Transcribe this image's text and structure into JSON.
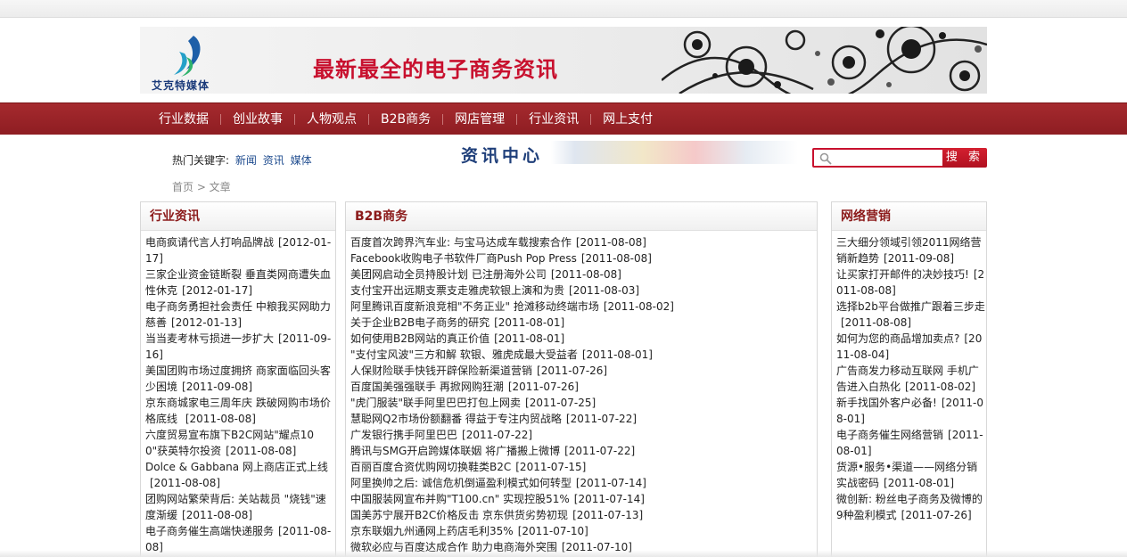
{
  "header": {
    "logo_text": "艾克特媒体",
    "slogan": "最新最全的电子商务资讯"
  },
  "nav": {
    "items": [
      "行业数据",
      "创业故事",
      "人物观点",
      "B2B商务",
      "网店管理",
      "行业资讯",
      "网上支付"
    ]
  },
  "hot_keywords": {
    "label": "热门关键字:",
    "words": [
      "新闻",
      "资讯",
      "媒体"
    ]
  },
  "center_banner": {
    "title": "资讯中心"
  },
  "search": {
    "placeholder": "",
    "button_label": "搜 索"
  },
  "breadcrumb": "首页 > 文章",
  "columns": {
    "left": {
      "title": "行业资讯",
      "items": [
        {
          "title": "电商疯请代言人打响品牌战",
          "date": "[2012-01-17]"
        },
        {
          "title": "三家企业资金链断裂 垂直类网商遭失血性休克",
          "date": "[2012-01-17]"
        },
        {
          "title": "电子商务勇担社会责任 中粮我买网助力慈善",
          "date": "[2012-01-13]"
        },
        {
          "title": "当当麦考林亏损进一步扩大",
          "date": "[2011-09-16]"
        },
        {
          "title": "美国团购市场过度拥挤 商家面临回头客少困境",
          "date": "[2011-09-08]"
        },
        {
          "title": "京东商城家电三周年庆 跌破网购市场价格底线 ",
          "date": "[2011-08-08]"
        },
        {
          "title": "六度贸易宣布旗下B2C网站\"耀点100\"获英特尔投资",
          "date": "[2011-08-08]"
        },
        {
          "title": "Dolce & Gabbana 网上商店正式上线",
          "date": "[2011-08-08]"
        },
        {
          "title": "团购网站繁荣背后: 关站裁员 \"烧钱\"速度渐缓",
          "date": "[2011-08-08]"
        },
        {
          "title": "电子商务催生高端快递服务",
          "date": "[2011-08-08]"
        }
      ]
    },
    "middle": {
      "title": "B2B商务",
      "items": [
        {
          "title": "百度首次跨界汽车业: 与宝马达成车载搜索合作",
          "date": "[2011-08-08]"
        },
        {
          "title": "Facebook收购电子书软件厂商Push Pop Press",
          "date": "[2011-08-08]"
        },
        {
          "title": "美团网启动全员持股计划 已注册海外公司",
          "date": "[2011-08-08]"
        },
        {
          "title": "支付宝开出远期支票支走雅虎软银上演和为贵",
          "date": "[2011-08-03]"
        },
        {
          "title": "阿里腾讯百度新浪竞相\"不务正业\" 抢滩移动终端市场",
          "date": "[2011-08-02]"
        },
        {
          "title": "关于企业B2B电子商务的研究",
          "date": "[2011-08-01]"
        },
        {
          "title": "如何使用B2B网站的真正价值",
          "date": "[2011-08-01]"
        },
        {
          "title": "\"支付宝风波\"三方和解 软银、雅虎成最大受益者",
          "date": "[2011-08-01]"
        },
        {
          "title": "人保财险联手快钱开辟保险新渠道营销",
          "date": "[2011-07-26]"
        },
        {
          "title": "百度国美强强联手 再掀网购狂潮",
          "date": "[2011-07-26]"
        },
        {
          "title": "\"虎门服装\"联手阿里巴巴打包上网卖",
          "date": "[2011-07-25]"
        },
        {
          "title": "慧聪网Q2市场份额翻番 得益于专注内贸战略",
          "date": "[2011-07-22]"
        },
        {
          "title": "广发银行携手阿里巴巴",
          "date": "[2011-07-22]"
        },
        {
          "title": "腾讯与SMG开启跨媒体联姻 将广播搬上微博",
          "date": "[2011-07-22]"
        },
        {
          "title": "百丽百度合资优购网切换鞋类B2C",
          "date": "[2011-07-15]"
        },
        {
          "title": "阿里换帅之后: 诚信危机倒逼盈利模式如何转型",
          "date": "[2011-07-14]"
        },
        {
          "title": "中国服装网宣布并购\"T100.cn\" 实现控股51%",
          "date": "[2011-07-14]"
        },
        {
          "title": "国美苏宁展开B2C价格反击 京东供货劣势初现",
          "date": "[2011-07-13]"
        },
        {
          "title": "京东联姻九州通网上药店毛利35%",
          "date": "[2011-07-10]"
        },
        {
          "title": "微软必应与百度达成合作 助力电商海外突围",
          "date": "[2011-07-10]"
        }
      ]
    },
    "right": {
      "title": "网络营销",
      "items": [
        {
          "title": "三大细分领域引领2011网络营销新趋势",
          "date": "[2011-09-08]"
        },
        {
          "title": "让买家打开邮件的决妙技巧!",
          "date": "[2011-08-08]"
        },
        {
          "title": "选择b2b平台做推广跟着三步走",
          "date": "[2011-08-08]"
        },
        {
          "title": "如何为您的商品增加卖点?",
          "date": "[2011-08-04]"
        },
        {
          "title": "广告商发力移动互联网 手机广告进入白热化",
          "date": "[2011-08-02]"
        },
        {
          "title": "新手找国外客户必备!",
          "date": "[2011-08-01]"
        },
        {
          "title": "电子商务催生网络营销",
          "date": "[2011-08-01]"
        },
        {
          "title": "货源•服务•渠道——网络分销实战密码",
          "date": "[2011-08-01]"
        },
        {
          "title": "微创新: 粉丝电子商务及微博的9种盈利模式",
          "date": "[2011-07-26]"
        }
      ]
    }
  }
}
